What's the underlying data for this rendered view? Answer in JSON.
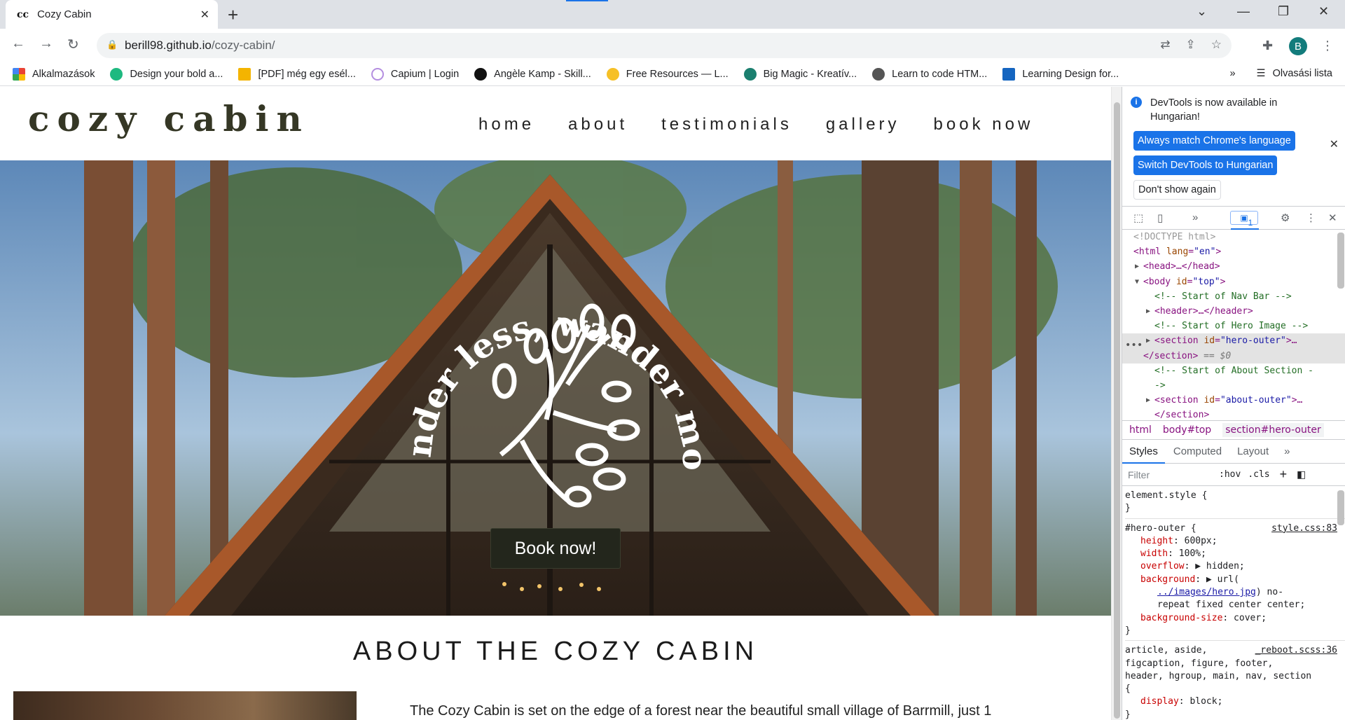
{
  "browser": {
    "tab_title": "Cozy Cabin",
    "tab_favicon": "cc",
    "url_host": "berill98.github.io",
    "url_path": "/cozy-cabin/",
    "avatar_letter": "B",
    "bookmarks": [
      {
        "label": "Alkalmazások",
        "color": "#ea4335"
      },
      {
        "label": "Design your bold a...",
        "color": "#1eb980"
      },
      {
        "label": "[PDF] még egy esél...",
        "color": "#f4b400"
      },
      {
        "label": "Capium | Login",
        "color": "#b48ee0"
      },
      {
        "label": "Angèle Kamp - Skill...",
        "color": "#111111"
      },
      {
        "label": "Free Resources — L...",
        "color": "#f6c026"
      },
      {
        "label": "Big Magic - Kreatív...",
        "color": "#1b7f6f"
      },
      {
        "label": "Learn to code HTM...",
        "color": "#555555"
      },
      {
        "label": "Learning Design for...",
        "color": "#1565c0"
      }
    ],
    "reading_list": "Olvasási lista"
  },
  "site": {
    "logo": "cozy cabin",
    "nav": [
      "home",
      "about",
      "testimonials",
      "gallery",
      "book now"
    ],
    "hero_arc_text": "wonder less, wander more",
    "hero_button": "Book now!",
    "about_title": "ABOUT THE COZY CABIN",
    "about_text": "The Cozy Cabin is set on the edge of a forest near the beautiful small village of Barrmill, just 1"
  },
  "devtools": {
    "info_text": "DevTools is now available in Hungarian!",
    "btn_match": "Always match Chrome's language",
    "btn_switch": "Switch DevTools to Hungarian",
    "btn_dont_show": "Don't show again",
    "issues_count": "1",
    "dom": {
      "doctype": "<!DOCTYPE html>",
      "html_open_tag": "<html ",
      "html_lang_attr": "lang",
      "html_lang_val": "\"en\"",
      "html_close": ">",
      "head": "<head>…</head>",
      "body_tag": "<body ",
      "body_attr": "id",
      "body_val": "\"top\"",
      "body_close": ">",
      "c_nav": "<!-- Start of Nav Bar -->",
      "header": "<header>…</header>",
      "c_hero": "<!-- Start of Hero Image -->",
      "section_tag": "<section ",
      "section_attr": "id",
      "hero_val": "\"hero-outer\"",
      "hero_tail": ">…",
      "section_close": "</section>",
      "eq_ref": " == $0",
      "c_about": "<!-- Start of About Section -",
      "c_about_2": "->",
      "about_val": "\"about-outer\"",
      "about_tail": ">…",
      "section_close_2": "</section>"
    },
    "breadcrumbs": [
      "html",
      "body#top",
      "section#hero-outer"
    ],
    "pane_tabs": [
      "Styles",
      "Computed",
      "Layout"
    ],
    "filter_placeholder": "Filter",
    "filter_hov": ":hov",
    "filter_cls": ".cls",
    "styles": {
      "element_style": "element.style {",
      "close_brace": "}",
      "hero_selector": "#hero-outer {",
      "hero_src": "style.css:83",
      "height_name": "height",
      "height_val": ": 600px;",
      "width_name": "width",
      "width_val": ": 100%;",
      "overflow_name": "overflow",
      "overflow_val": ": ▶ hidden;",
      "background_name": "background",
      "background_val": ": ▶ url(",
      "bg_link": "../images/hero.jpg",
      "bg_tail": ") no-",
      "bg_tail2": "repeat fixed center center;",
      "bgsize_name": "background-size",
      "bgsize_val": ": cover;",
      "reboot_selector": "article, aside,",
      "reboot_src": "_reboot.scss:36",
      "reboot_sel2": "figcaption, figure, footer,",
      "reboot_sel3": "header, hgroup, main, nav, section",
      "reboot_open": "{",
      "display_name": "display",
      "display_val": ": block;"
    }
  },
  "colors": {
    "accent": "#1a73e8",
    "site_text": "#353725",
    "hero_button_bg": "#23261c"
  }
}
